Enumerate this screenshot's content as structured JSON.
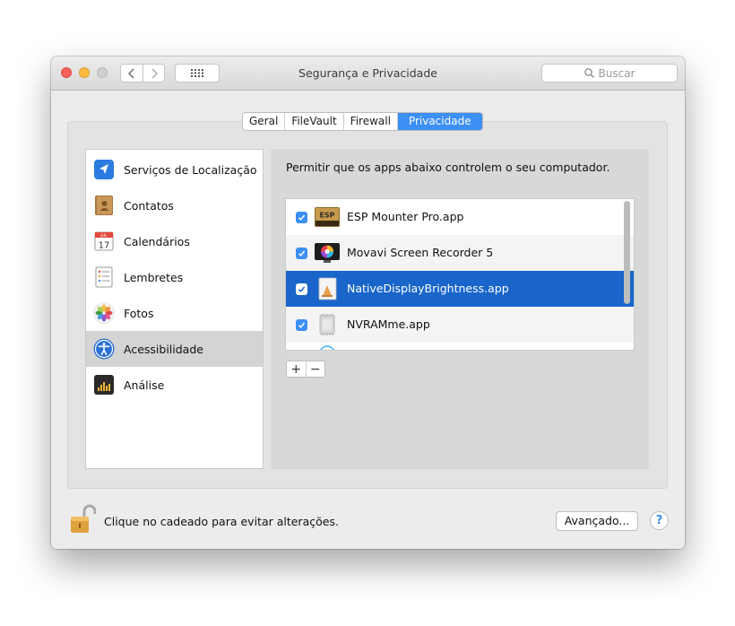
{
  "window": {
    "title": "Segurança e Privacidade",
    "search_placeholder": "Buscar"
  },
  "tabs": [
    {
      "label": "Geral",
      "active": false
    },
    {
      "label": "FileVault",
      "active": false
    },
    {
      "label": "Firewall",
      "active": false
    },
    {
      "label": "Privacidade",
      "active": true
    }
  ],
  "sidebar": {
    "items": [
      {
        "label": "Serviços de Localização",
        "icon": "location-arrow-icon",
        "selected": false
      },
      {
        "label": "Contatos",
        "icon": "contacts-book-icon",
        "selected": false
      },
      {
        "label": "Calendários",
        "icon": "calendar-icon",
        "selected": false,
        "icon_text_month": "JUL",
        "icon_text_day": "17"
      },
      {
        "label": "Lembretes",
        "icon": "reminders-list-icon",
        "selected": false
      },
      {
        "label": "Fotos",
        "icon": "photos-flower-icon",
        "selected": false
      },
      {
        "label": "Acessibilidade",
        "icon": "accessibility-icon",
        "selected": true
      },
      {
        "label": "Análise",
        "icon": "analytics-icon",
        "selected": false
      }
    ]
  },
  "main": {
    "description": "Permitir que os apps abaixo controlem o seu computador.",
    "apps": [
      {
        "name": "ESP Mounter Pro.app",
        "checked": true,
        "selected": false,
        "icon": "esp-drive-icon",
        "icon_text": "ESP"
      },
      {
        "name": "Movavi Screen Recorder 5",
        "checked": true,
        "selected": false,
        "icon": "movavi-monitor-icon"
      },
      {
        "name": "NativeDisplayBrightness.app",
        "checked": true,
        "selected": true,
        "icon": "generic-app-icon"
      },
      {
        "name": "NVRAMme.app",
        "checked": true,
        "selected": false,
        "icon": "chip-icon"
      }
    ],
    "add_label": "+",
    "remove_label": "−"
  },
  "footer": {
    "lock_text": "Clique no cadeado para evitar alterações.",
    "advanced_label": "Avançado...",
    "help_label": "?"
  },
  "colors": {
    "accent": "#3b8ff5",
    "selection": "#1965c9"
  }
}
